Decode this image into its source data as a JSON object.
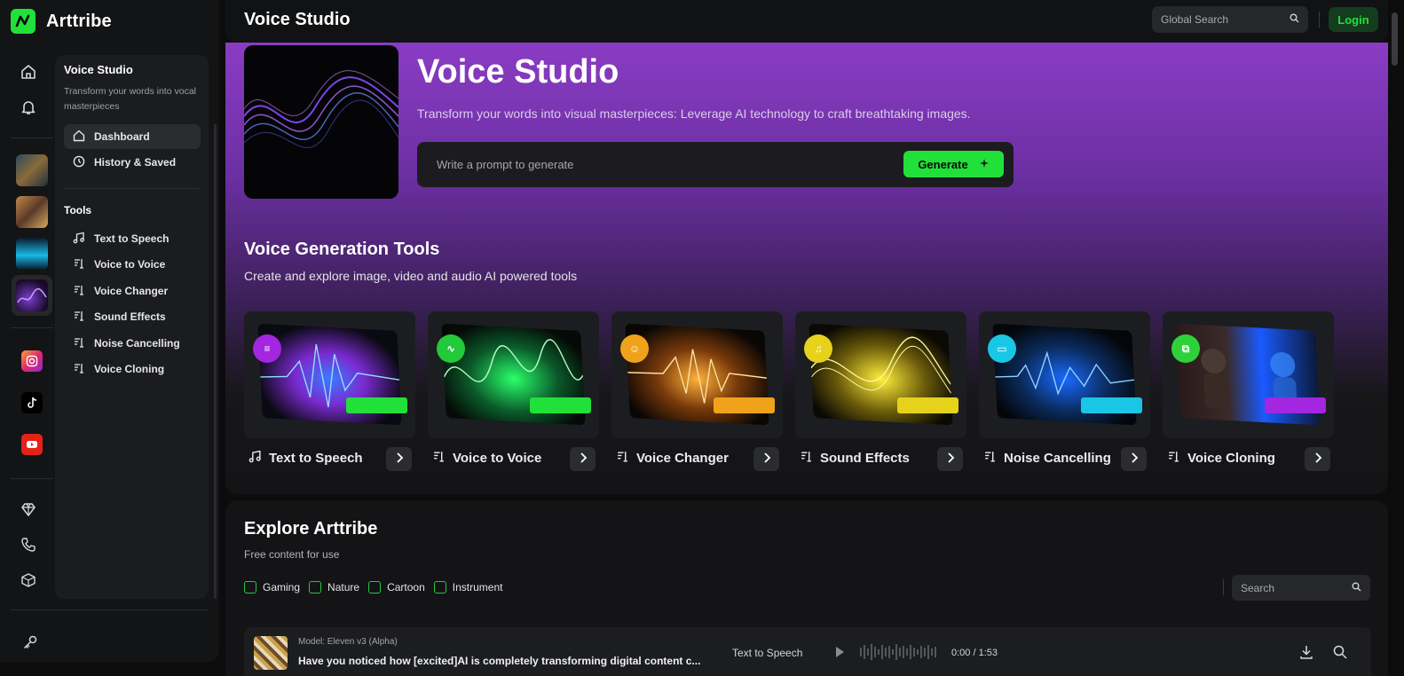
{
  "brand": {
    "name": "Arttribe"
  },
  "topbar": {
    "title": "Voice Studio",
    "search_placeholder": "Global Search",
    "login_label": "Login"
  },
  "subnav": {
    "title": "Voice Studio",
    "description": "Transform your words into vocal masterpieces",
    "items": [
      {
        "label": "Dashboard",
        "icon": "home-icon"
      },
      {
        "label": "History & Saved",
        "icon": "clock-icon"
      }
    ],
    "tools_heading": "Tools",
    "tools": [
      {
        "label": "Text to Speech",
        "icon": "music-note-icon"
      },
      {
        "label": "Voice to Voice",
        "icon": "voice-icon"
      },
      {
        "label": "Voice Changer",
        "icon": "voice-icon"
      },
      {
        "label": "Sound Effects",
        "icon": "voice-icon"
      },
      {
        "label": "Noise Cancelling",
        "icon": "voice-icon"
      },
      {
        "label": "Voice Cloning",
        "icon": "voice-icon"
      }
    ]
  },
  "hero": {
    "title": "Voice Studio",
    "subtitle": "Transform your words into visual masterpieces: Leverage AI technology to craft breathtaking images.",
    "prompt_placeholder": "Write a prompt to generate",
    "generate_label": "Generate"
  },
  "tools_section": {
    "title": "Voice Generation Tools",
    "subtitle": "Create and explore image, video and audio AI powered tools",
    "cards": [
      {
        "label": "Text to Speech",
        "accent": "#a326e0"
      },
      {
        "label": "Voice to Voice",
        "accent": "#22c93a"
      },
      {
        "label": "Voice Changer",
        "accent": "#f0a21a"
      },
      {
        "label": "Sound Effects",
        "accent": "#e6d21a"
      },
      {
        "label": "Noise Cancelling",
        "accent": "#1ac6e6"
      },
      {
        "label": "Voice Cloning",
        "accent": "#2fd13a"
      }
    ]
  },
  "explore": {
    "title": "Explore Arttribe",
    "subtitle": "Free content for use",
    "filters": [
      "Gaming",
      "Nature",
      "Cartoon",
      "Instrument"
    ],
    "search_placeholder": "Search",
    "track": {
      "model": "Model: Eleven v3 (Alpha)",
      "text": "Have you noticed how [excited]AI is completely transforming digital content c...",
      "type": "Text to Speech",
      "time": "0:00 / 1:53"
    }
  },
  "colors": {
    "accent": "#22e03a",
    "hero_gradient_top": "#8a3cc4"
  }
}
